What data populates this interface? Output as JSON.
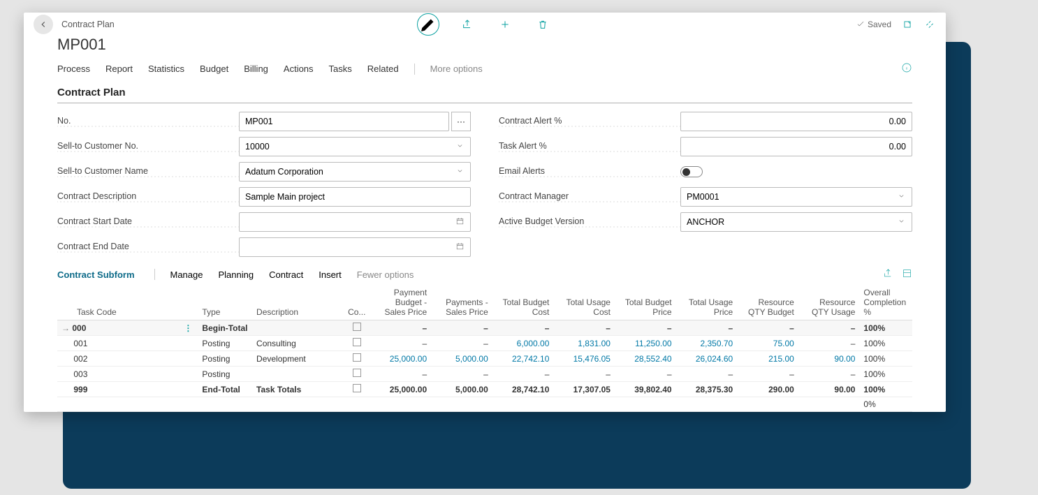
{
  "header": {
    "breadcrumb": "Contract Plan",
    "title": "MP001",
    "saved": "Saved"
  },
  "menu": {
    "items": [
      "Process",
      "Report",
      "Statistics",
      "Budget",
      "Billing",
      "Actions",
      "Tasks",
      "Related"
    ],
    "more": "More options"
  },
  "section_title": "Contract Plan",
  "form": {
    "left": [
      {
        "label": "No.",
        "value": "MP001",
        "type": "ellipsis"
      },
      {
        "label": "Sell-to Customer No.",
        "value": "10000",
        "type": "select"
      },
      {
        "label": "Sell-to Customer Name",
        "value": "Adatum Corporation",
        "type": "select"
      },
      {
        "label": "Contract Description",
        "value": "Sample Main project",
        "type": "text"
      },
      {
        "label": "Contract Start Date",
        "value": "",
        "type": "date"
      },
      {
        "label": "Contract End Date",
        "value": "",
        "type": "date"
      }
    ],
    "right": [
      {
        "label": "Contract Alert %",
        "value": "0.00",
        "type": "number"
      },
      {
        "label": "Task Alert %",
        "value": "0.00",
        "type": "number"
      },
      {
        "label": "Email Alerts",
        "value": "off",
        "type": "toggle"
      },
      {
        "label": "Contract Manager",
        "value": "PM0001",
        "type": "select"
      },
      {
        "label": "Active Budget Version",
        "value": "ANCHOR",
        "type": "select"
      }
    ]
  },
  "subform": {
    "title": "Contract Subform",
    "menu": [
      "Manage",
      "Planning",
      "Contract",
      "Insert"
    ],
    "fewer": "Fewer options",
    "cols": [
      "Task Code",
      "Type",
      "Description",
      "Co...",
      "Payment Budget - Sales Price",
      "Payments - Sales Price",
      "Total Budget Cost",
      "Total Usage Cost",
      "Total Budget Price",
      "Total Usage Price",
      "Resource QTY Budget",
      "Resource QTY Usage",
      "Overall Completion %"
    ],
    "rows": [
      {
        "selected": true,
        "bold": true,
        "code": "000",
        "type": "Begin-Total",
        "desc": "",
        "pb": "–",
        "ps": "–",
        "tbc": "–",
        "tuc": "–",
        "tbp": "–",
        "tup": "–",
        "rqb": "–",
        "rqu": "–",
        "comp": "100%"
      },
      {
        "code": "001",
        "type": "Posting",
        "desc": "Consulting",
        "pb": "–",
        "ps": "–",
        "tbc": "6,000.00",
        "tuc": "1,831.00",
        "tbp": "11,250.00",
        "tup": "2,350.70",
        "rqb": "75.00",
        "rqu": "–",
        "comp": "100%",
        "link": true
      },
      {
        "code": "002",
        "type": "Posting",
        "desc": "Development",
        "pb": "25,000.00",
        "ps": "5,000.00",
        "tbc": "22,742.10",
        "tuc": "15,476.05",
        "tbp": "28,552.40",
        "tup": "26,024.60",
        "rqb": "215.00",
        "rqu": "90.00",
        "comp": "100%",
        "link": true
      },
      {
        "code": "003",
        "type": "Posting",
        "desc": "",
        "pb": "–",
        "ps": "–",
        "tbc": "–",
        "tuc": "–",
        "tbp": "–",
        "tup": "–",
        "rqb": "–",
        "rqu": "–",
        "comp": "100%"
      },
      {
        "bold": true,
        "code": "999",
        "type": "End-Total",
        "desc": "Task Totals",
        "pb": "25,000.00",
        "ps": "5,000.00",
        "tbc": "28,742.10",
        "tuc": "17,307.05",
        "tbp": "39,802.40",
        "tup": "28,375.30",
        "rqb": "290.00",
        "rqu": "90.00",
        "comp": "100%"
      },
      {
        "code": "",
        "type": "",
        "desc": "",
        "pb": "",
        "ps": "",
        "tbc": "",
        "tuc": "",
        "tbp": "",
        "tup": "",
        "rqb": "",
        "rqu": "",
        "comp": "0%",
        "nocheck": true
      }
    ]
  }
}
